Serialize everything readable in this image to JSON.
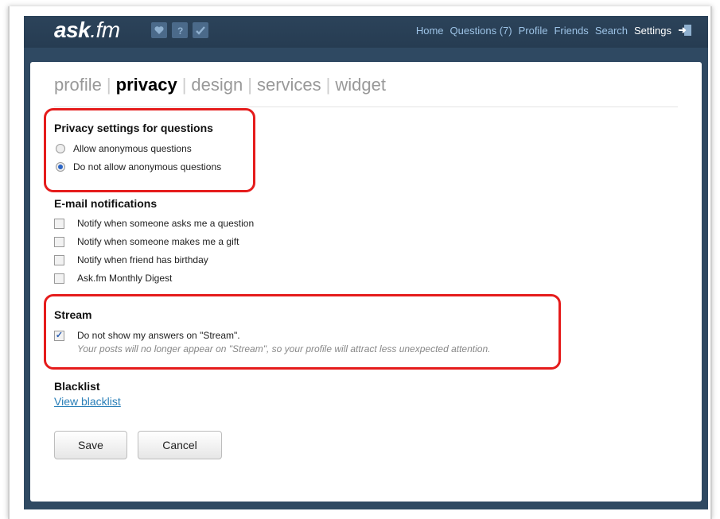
{
  "header": {
    "logo_main": "ask",
    "logo_suffix": ".fm",
    "nav": [
      "Home",
      "Questions (7)",
      "Profile",
      "Friends",
      "Search",
      "Settings"
    ],
    "active_nav": "Settings",
    "icons": [
      "heart-icon",
      "question-icon",
      "check-icon",
      "logout-icon"
    ]
  },
  "tabs": [
    "profile",
    "privacy",
    "design",
    "services",
    "widget"
  ],
  "active_tab": "privacy",
  "privacy": {
    "heading": "Privacy settings for questions",
    "options": [
      "Allow anonymous questions",
      "Do not allow anonymous questions"
    ],
    "selected": "Do not allow anonymous questions"
  },
  "email": {
    "heading": "E-mail notifications",
    "options": [
      "Notify when someone asks me a question",
      "Notify when someone makes me a gift",
      "Notify when friend has birthday",
      "Ask.fm Monthly Digest"
    ]
  },
  "stream": {
    "heading": "Stream",
    "option": "Do not show my answers on \"Stream\".",
    "checked": true,
    "note": "Your posts will no longer appear on \"Stream\", so your profile will attract less unexpected attention."
  },
  "blacklist": {
    "heading": "Blacklist",
    "link": "View blacklist"
  },
  "buttons": {
    "save": "Save",
    "cancel": "Cancel"
  },
  "colors": {
    "header_bg": "#2c435a",
    "nav_link": "#9dc3e6",
    "highlight": "#e51c1c",
    "link": "#2a7fb8"
  }
}
